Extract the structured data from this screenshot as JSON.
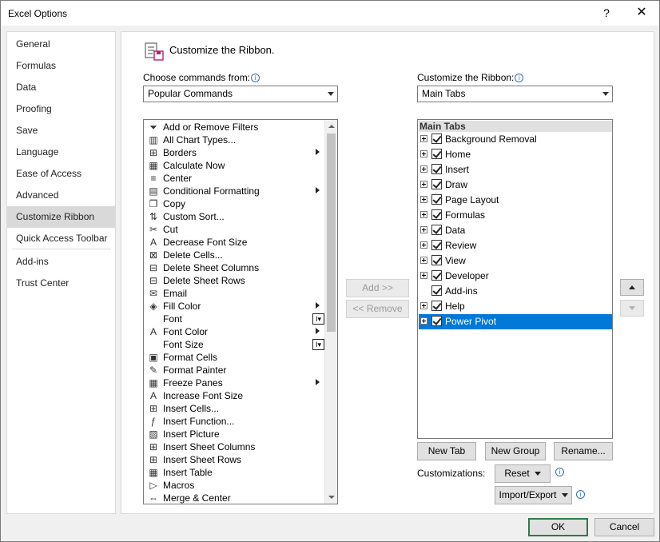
{
  "window": {
    "title": "Excel Options",
    "help": "?",
    "close": "✕"
  },
  "nav": {
    "items": [
      "General",
      "Formulas",
      "Data",
      "Proofing",
      "Save",
      "Language",
      "Ease of Access",
      "Advanced",
      "Customize Ribbon",
      "Quick Access Toolbar",
      "Add-ins",
      "Trust Center"
    ],
    "active": "Customize Ribbon"
  },
  "header": {
    "title": "Customize the Ribbon."
  },
  "left": {
    "label": "Choose commands from:",
    "combo_value": "Popular Commands",
    "commands": [
      {
        "label": "Add or Remove Filters",
        "icon": "filter-icon"
      },
      {
        "label": "All Chart Types...",
        "icon": "chart-icon"
      },
      {
        "label": "Borders",
        "icon": "borders-icon"
      },
      {
        "label": "Calculate Now",
        "icon": "calculator-icon"
      },
      {
        "label": "Center",
        "icon": "align-center-icon"
      },
      {
        "label": "Conditional Formatting",
        "icon": "conditional-formatting-icon"
      },
      {
        "label": "Copy",
        "icon": "copy-icon"
      },
      {
        "label": "Custom Sort...",
        "icon": "sort-icon"
      },
      {
        "label": "Cut",
        "icon": "scissors-icon"
      },
      {
        "label": "Decrease Font Size",
        "icon": "font-decrease-icon"
      },
      {
        "label": "Delete Cells...",
        "icon": "delete-cells-icon"
      },
      {
        "label": "Delete Sheet Columns",
        "icon": "delete-columns-icon"
      },
      {
        "label": "Delete Sheet Rows",
        "icon": "delete-rows-icon"
      },
      {
        "label": "Email",
        "icon": "email-icon"
      },
      {
        "label": "Fill Color",
        "icon": "fill-color-icon"
      },
      {
        "label": "Font",
        "icon": "font-icon"
      },
      {
        "label": "Font Color",
        "icon": "font-color-icon"
      },
      {
        "label": "Font Size",
        "icon": "font-size-icon"
      },
      {
        "label": "Format Cells",
        "icon": "format-cells-icon"
      },
      {
        "label": "Format Painter",
        "icon": "format-painter-icon"
      },
      {
        "label": "Freeze Panes",
        "icon": "freeze-panes-icon"
      },
      {
        "label": "Increase Font Size",
        "icon": "font-increase-icon"
      },
      {
        "label": "Insert Cells...",
        "icon": "insert-cells-icon"
      },
      {
        "label": "Insert Function...",
        "icon": "function-icon"
      },
      {
        "label": "Insert Picture",
        "icon": "picture-icon"
      },
      {
        "label": "Insert Sheet Columns",
        "icon": "insert-columns-icon"
      },
      {
        "label": "Insert Sheet Rows",
        "icon": "insert-rows-icon"
      },
      {
        "label": "Insert Table",
        "icon": "table-icon"
      },
      {
        "label": "Macros",
        "icon": "macro-icon"
      },
      {
        "label": "Merge & Center",
        "icon": "merge-icon"
      }
    ]
  },
  "middle": {
    "add": "Add >>",
    "remove": "<< Remove"
  },
  "right": {
    "label": "Customize the Ribbon:",
    "combo_value": "Main Tabs",
    "tree_header": "Main Tabs",
    "tabs": [
      "Background Removal",
      "Home",
      "Insert",
      "Draw",
      "Page Layout",
      "Formulas",
      "Data",
      "Review",
      "View",
      "Developer",
      "Add-ins",
      "Help",
      "Power Pivot"
    ],
    "selected": "Power Pivot",
    "new_tab": "New Tab",
    "new_group": "New Group",
    "rename": "Rename...",
    "customizations_label": "Customizations:",
    "reset": "Reset",
    "import_export": "Import/Export"
  },
  "footer": {
    "ok": "OK",
    "cancel": "Cancel"
  },
  "colors": {
    "selection": "#0078d7",
    "ok_border": "#2c7a4b"
  }
}
